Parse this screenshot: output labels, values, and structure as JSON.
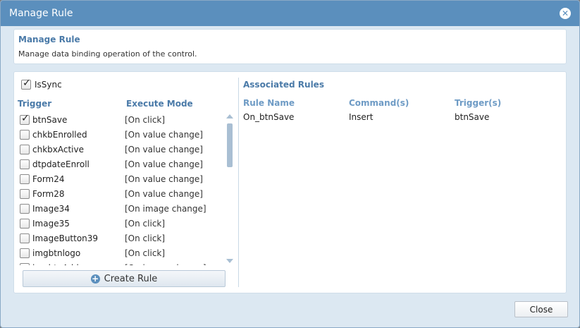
{
  "dialog": {
    "title": "Manage Rule",
    "close_icon": "close-icon"
  },
  "header": {
    "title": "Manage Rule",
    "description": "Manage data binding operation of the control."
  },
  "issync": {
    "label": "IsSync",
    "checked": true
  },
  "columns": {
    "trigger": "Trigger",
    "execute_mode": "Execute Mode"
  },
  "triggers": [
    {
      "name": "btnSave",
      "mode": "[On click]",
      "checked": true
    },
    {
      "name": "chkbEnrolled",
      "mode": "[On value change]",
      "checked": false
    },
    {
      "name": "chkbxActive",
      "mode": "[On value change]",
      "checked": false
    },
    {
      "name": "dtpdateEnroll",
      "mode": "[On value change]",
      "checked": false
    },
    {
      "name": "Form24",
      "mode": "[On value change]",
      "checked": false
    },
    {
      "name": "Form28",
      "mode": "[On value change]",
      "checked": false
    },
    {
      "name": "Image34",
      "mode": "[On image change]",
      "checked": false
    },
    {
      "name": "Image35",
      "mode": "[On click]",
      "checked": false
    },
    {
      "name": "ImageButton39",
      "mode": "[On click]",
      "checked": false
    },
    {
      "name": "imgbtnlogo",
      "mode": "[On click]",
      "checked": false
    },
    {
      "name": "imgbtnAdd",
      "mode": "[On image change]",
      "checked": false
    }
  ],
  "create_rule_label": "Create Rule",
  "associated": {
    "title": "Associated Rules",
    "headers": {
      "rule_name": "Rule Name",
      "commands": "Command(s)",
      "triggers": "Trigger(s)"
    },
    "rules": [
      {
        "rule_name": "On_btnSave",
        "commands": "Insert",
        "triggers": "btnSave"
      }
    ]
  },
  "close_label": "Close",
  "colors": {
    "titlebar": "#5b8fbd",
    "accent_text": "#4a7aa8",
    "dialog_bg": "#dce8f2"
  }
}
